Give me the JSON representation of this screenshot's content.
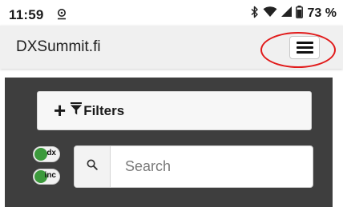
{
  "status_bar": {
    "time": "11:59",
    "battery_text": "73 %",
    "icons": [
      "location-icon",
      "bluetooth-icon",
      "wifi-icon",
      "signal-icon",
      "battery-icon"
    ]
  },
  "header": {
    "title": "DXSummit.fi",
    "menu_icon": "hamburger-menu-icon",
    "annotation_color": "#e11a1a"
  },
  "filters": {
    "label": "Filters",
    "icons": [
      "plus-icon",
      "funnel-icon"
    ]
  },
  "toggles": [
    {
      "label": "dx",
      "on": true,
      "color": "#3c9a3c"
    },
    {
      "label": "inc",
      "on": true,
      "color": "#3c9a3c"
    }
  ],
  "search": {
    "placeholder": "Search",
    "value": "",
    "icon": "search-icon"
  },
  "colors": {
    "panel_background": "#3e3e3e",
    "header_background": "#f0f0f0"
  }
}
